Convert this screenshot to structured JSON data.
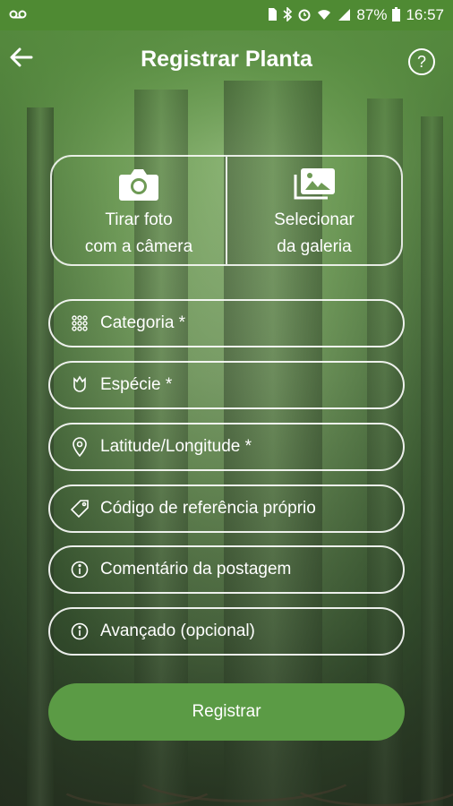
{
  "status": {
    "battery": "87%",
    "time": "16:57"
  },
  "header": {
    "title": "Registrar Planta",
    "help": "?"
  },
  "photo": {
    "camera_line1": "Tirar foto",
    "camera_line2": "com a câmera",
    "gallery_line1": "Selecionar",
    "gallery_line2": "da galeria"
  },
  "form": {
    "fields": [
      {
        "label": "Categoria *",
        "icon": "grid-icon"
      },
      {
        "label": "Espécie *",
        "icon": "flower-icon"
      },
      {
        "label": "Latitude/Longitude *",
        "icon": "location-pin-icon"
      },
      {
        "label": "Código de referência próprio",
        "icon": "tag-icon"
      },
      {
        "label": "Comentário da postagem",
        "icon": "info-icon"
      },
      {
        "label": "Avançado (opcional)",
        "icon": "info-icon"
      }
    ],
    "submit_label": "Registrar"
  },
  "colors": {
    "statusbar": "#4f8a33",
    "button": "#5b9b45"
  }
}
